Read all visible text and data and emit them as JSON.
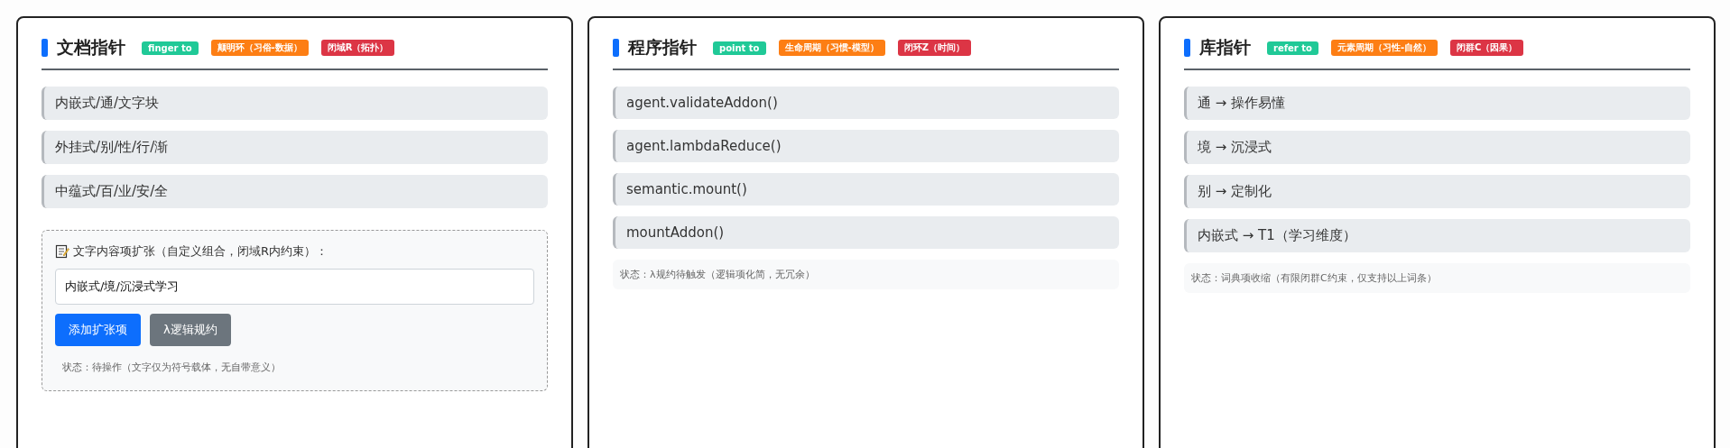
{
  "cards": [
    {
      "title": "文档指针",
      "badges": [
        {
          "label": "finger to",
          "color": "#20c997"
        },
        {
          "label": "颠明环（习俗-数据）",
          "color": "#fd7e14"
        },
        {
          "label": "闭域R（拓扑）",
          "color": "#dc3545"
        }
      ],
      "items": [
        "内嵌式/通/文字块",
        "外挂式/别/性/行/渐",
        "中蕴式/百/业/安/全"
      ],
      "editor": {
        "label": "文字内容项扩张（自定义组合，闭域R内约束）：",
        "value": "内嵌式/境/沉浸式学习",
        "buttons": [
          {
            "label": "添加扩张项",
            "kind": "primary"
          },
          {
            "label": "λ逻辑规约",
            "kind": "secondary"
          }
        ],
        "status": "状态：待操作（文字仅为符号载体，无自带意义）"
      }
    },
    {
      "title": "程序指针",
      "badges": [
        {
          "label": "point to",
          "color": "#20c997"
        },
        {
          "label": "生命周期（习惯-模型）",
          "color": "#fd7e14"
        },
        {
          "label": "闭环Z（时间）",
          "color": "#dc3545"
        }
      ],
      "items": [
        "agent.validateAddon()",
        "agent.lambdaReduce()",
        "semantic.mount()",
        "mountAddon()"
      ],
      "status": "状态：λ规约待触发（逻辑项化简，无冗余）"
    },
    {
      "title": "库指针",
      "badges": [
        {
          "label": "refer to",
          "color": "#20c997"
        },
        {
          "label": "元素周期（习性-自然）",
          "color": "#fd7e14"
        },
        {
          "label": "闭群C（因果）",
          "color": "#dc3545"
        }
      ],
      "items": [
        "通 → 操作易懂",
        "境 → 沉浸式",
        "别 → 定制化",
        "内嵌式 → T1（学习维度）"
      ],
      "status": "状态：词典项收缩（有限闭群C约束，仅支持以上词条）"
    }
  ]
}
